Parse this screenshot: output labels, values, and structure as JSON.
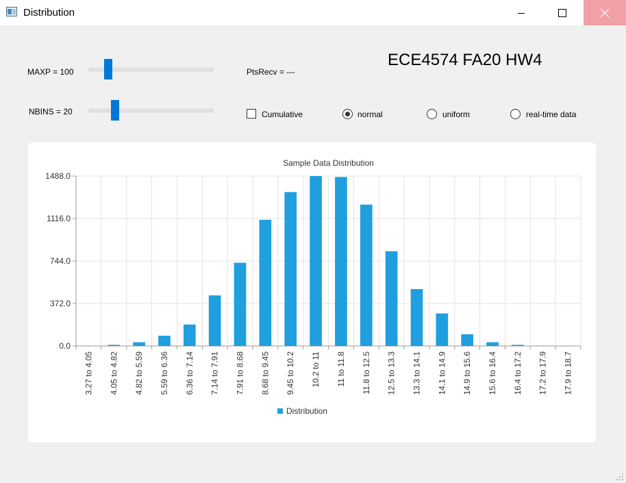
{
  "window": {
    "title": "Distribution",
    "icon": "app-window-icon",
    "controls": [
      "minimize-icon",
      "maximize-icon",
      "close-icon"
    ]
  },
  "controls": {
    "maxp_label": "MAXP = 100",
    "nbins_label": "NBINS = 20",
    "pts_recv": "PtsRecv = ---",
    "hw_title": "ECE4574 FA20 HW4",
    "cumulative_label": "Cumulative",
    "cumulative_checked": false,
    "radio_normal": "normal",
    "radio_uniform": "uniform",
    "radio_realtime": "real-time data",
    "selected_radio": "normal",
    "maxp_slider_fraction": 0.13,
    "nbins_slider_fraction": 0.19
  },
  "colors": {
    "bar": "#209fdf",
    "slider_accent": "#0078d7",
    "close_hover": "#f1a0a6"
  },
  "chart_data": {
    "type": "bar",
    "title": "Sample Data Distribution",
    "categories": [
      "3.27 to 4.05",
      "4.05 to 4.82",
      "4.82 to 5.59",
      "5.59 to 6.36",
      "6.36 to 7.14",
      "7.14 to 7.91",
      "7.91 to 8.68",
      "8.68 to 9.45",
      "9.45 to 10.2",
      "10.2 to 11",
      "11 to 11.8",
      "11.8 to 12.5",
      "12.5 to 13.3",
      "13.3 to 14.1",
      "14.1 to 14.9",
      "14.9 to 15.6",
      "15.6 to 16.4",
      "16.4 to 17.2",
      "17.2 to 17.9",
      "17.9 to 18.7"
    ],
    "series": [
      {
        "name": "Distribution",
        "values": [
          1,
          10,
          33,
          90,
          188,
          443,
          729,
          1105,
          1348,
          1488,
          1480,
          1238,
          830,
          498,
          285,
          103,
          33,
          10,
          2,
          1
        ]
      }
    ],
    "yticks": [
      "0.0",
      "372.0",
      "744.0",
      "1116.0",
      "1488.0"
    ],
    "ylim": [
      0,
      1488
    ],
    "grid": true,
    "legend_position": "bottom"
  }
}
